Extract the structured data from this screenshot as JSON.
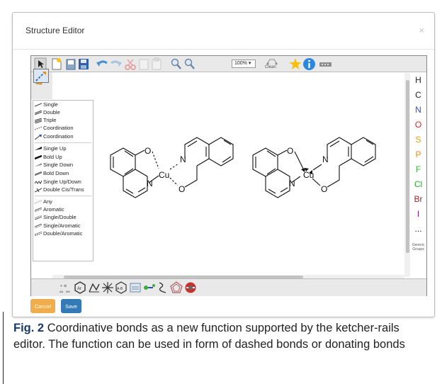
{
  "modal": {
    "title": "Structure Editor",
    "close_glyph": "×"
  },
  "toolbar": {
    "zoom_value": "100% ▾",
    "clean_label": "Clean",
    "icons": [
      "select-icon",
      "new-file-icon",
      "open-icon",
      "save-icon",
      "undo-icon",
      "redo-icon",
      "cut-icon",
      "copy-icon",
      "paste-icon",
      "zoom-in-icon",
      "zoom-out-icon",
      "clean-icon",
      "star-icon",
      "info-icon",
      "template-icon"
    ]
  },
  "bond_menu": {
    "items": [
      "Single",
      "Double",
      "Triple",
      "Coordination",
      "Coordination",
      "Single Up",
      "Bold Up",
      "Single Down",
      "Bold Down",
      "Single Up/Down",
      "Double Cis/Trans",
      "Any",
      "Aromatic",
      "Single/Double",
      "Single/Aromatic",
      "Double/Aromatic"
    ]
  },
  "atoms": [
    {
      "symbol": "H",
      "color": "#222222"
    },
    {
      "symbol": "C",
      "color": "#222222"
    },
    {
      "symbol": "N",
      "color": "#2b4bd8"
    },
    {
      "symbol": "O",
      "color": "#e0231c"
    },
    {
      "symbol": "S",
      "color": "#d9a514"
    },
    {
      "symbol": "P",
      "color": "#f08a18"
    },
    {
      "symbol": "F",
      "color": "#3ab13a"
    },
    {
      "symbol": "Cl",
      "color": "#2eaa2e"
    },
    {
      "symbol": "Br",
      "color": "#a3282b"
    },
    {
      "symbol": "I",
      "color": "#941b94"
    },
    {
      "symbol": "...",
      "color": "#222222"
    }
  ],
  "generic_groups_label": "Generic Groups",
  "molecules": {
    "left": {
      "labels": [
        "O",
        "N",
        "Cu",
        "N",
        "O"
      ]
    },
    "right": {
      "labels": [
        "O",
        "N",
        "Cu",
        "N",
        "O"
      ]
    }
  },
  "buttons": {
    "cancel": "Cancel",
    "save": "Save"
  },
  "caption": {
    "label": "Fig. 2",
    "text": "Coordinative bonds as a new function supported by the ketcher-rails editor. The function can be used in form of dashed bonds or donating bonds"
  }
}
